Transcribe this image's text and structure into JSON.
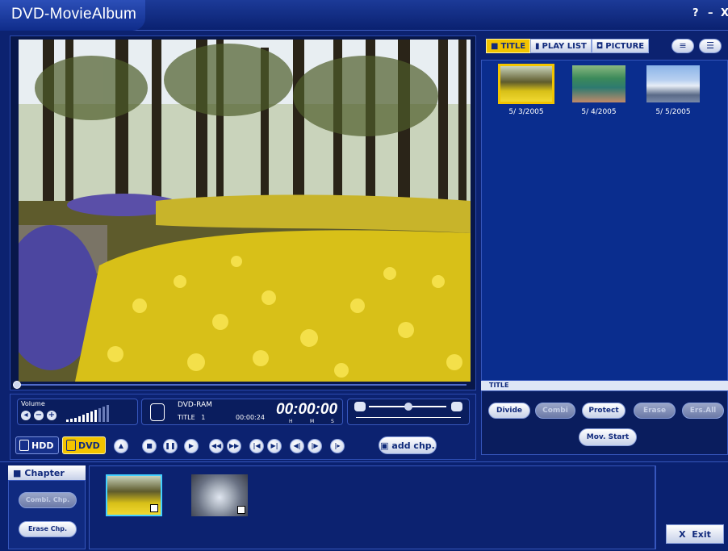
{
  "window": {
    "title": "DVD-MovieAlbum",
    "help": "?",
    "minimize": "–",
    "close": "X"
  },
  "colors": {
    "accent": "#f2c400",
    "background": "#0c2270",
    "panel": "#0a2d8e"
  },
  "player": {
    "volume_label": "Volume",
    "disc_type": "DVD-RAM",
    "title_label": "TITLE",
    "title_number": "1",
    "title_time": "00:00:24",
    "timecode": "00:00:00",
    "hms": [
      "H",
      "M",
      "S"
    ],
    "seek_position": 0
  },
  "drives": {
    "hdd": "HDD",
    "dvd": "DVD",
    "selected": "DVD"
  },
  "transport": {
    "icons": [
      "eject-icon",
      "stop-icon",
      "pause-icon",
      "play-icon",
      "rewind-icon",
      "fast-forward-icon",
      "skip-back-icon",
      "skip-forward-icon",
      "frame-back-icon",
      "frame-forward-icon",
      "slow-icon"
    ],
    "add_chapter": "add chp."
  },
  "tabs": [
    {
      "label": "TITLE",
      "icon": "camera-icon",
      "active": true
    },
    {
      "label": "PLAY LIST",
      "icon": "playlist-icon",
      "active": false
    },
    {
      "label": "PICTURE",
      "icon": "picture-icon",
      "active": false
    }
  ],
  "titles": [
    {
      "date": "5/ 3/2005",
      "selected": true
    },
    {
      "date": "5/ 4/2005",
      "selected": false
    },
    {
      "date": "5/ 5/2005",
      "selected": false
    }
  ],
  "section_label": "TITLE",
  "actions": [
    {
      "label": "Divide",
      "enabled": true
    },
    {
      "label": "Combi",
      "enabled": false
    },
    {
      "label": "Protect",
      "enabled": true
    },
    {
      "label": "Erase",
      "enabled": false
    },
    {
      "label": "Ers.All",
      "enabled": false
    }
  ],
  "mov_start": "Mov. Start",
  "chapter": {
    "header": "Chapter",
    "combi_chp": "Combi. Chp.",
    "erase_chp": "Erase Chp."
  },
  "exit": "Exit"
}
